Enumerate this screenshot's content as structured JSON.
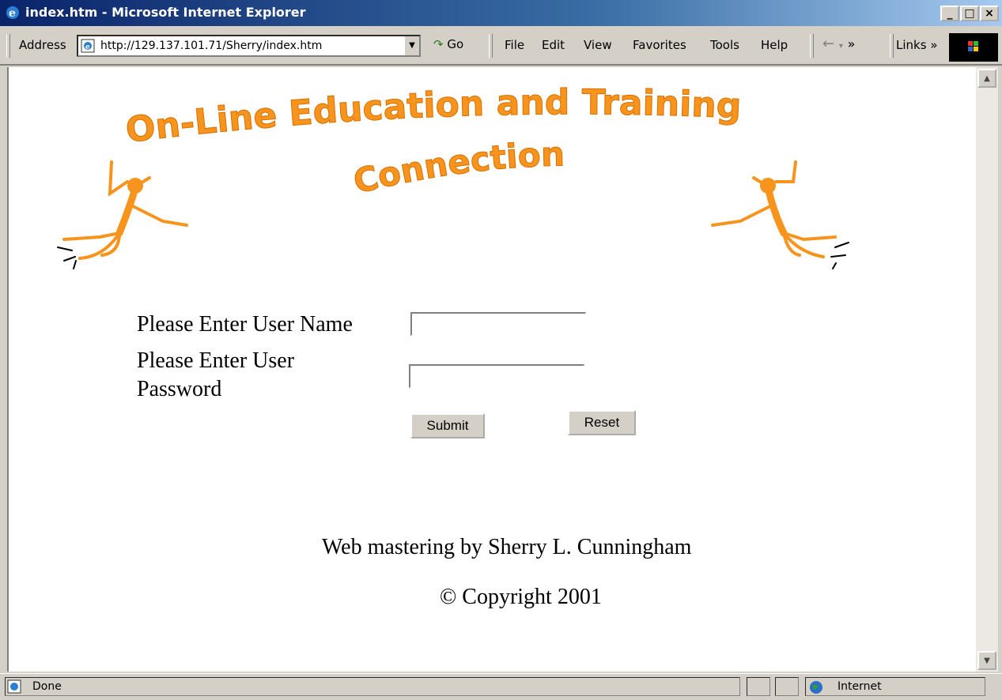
{
  "window": {
    "title": "index.htm - Microsoft Internet Explorer",
    "minimize_label": "_",
    "maximize_label": "□",
    "close_label": "×"
  },
  "toolbar": {
    "address_label": "Address",
    "address_value": "http://129.137.101.71/Sherry/index.htm",
    "go_label": "Go",
    "menu": {
      "file": "File",
      "edit": "Edit",
      "view": "View",
      "favorites": "Favorites",
      "tools": "Tools",
      "help": "Help"
    },
    "links_label": "Links",
    "chevron": "»"
  },
  "page": {
    "banner_line1": "On-Line Education and Training",
    "banner_line2": "Connection",
    "username_label": "Please Enter User Name",
    "username_value": "",
    "password_label_line1": "Please Enter User",
    "password_label_line2": "Password",
    "password_value": "",
    "submit_label": "Submit",
    "reset_label": "Reset",
    "webmaster_text": "Web mastering by Sherry L. Cunningham",
    "copyright_text": "© Copyright 2001",
    "accent_color": "#f7941d"
  },
  "status": {
    "text": "Done",
    "zone": "Internet"
  }
}
